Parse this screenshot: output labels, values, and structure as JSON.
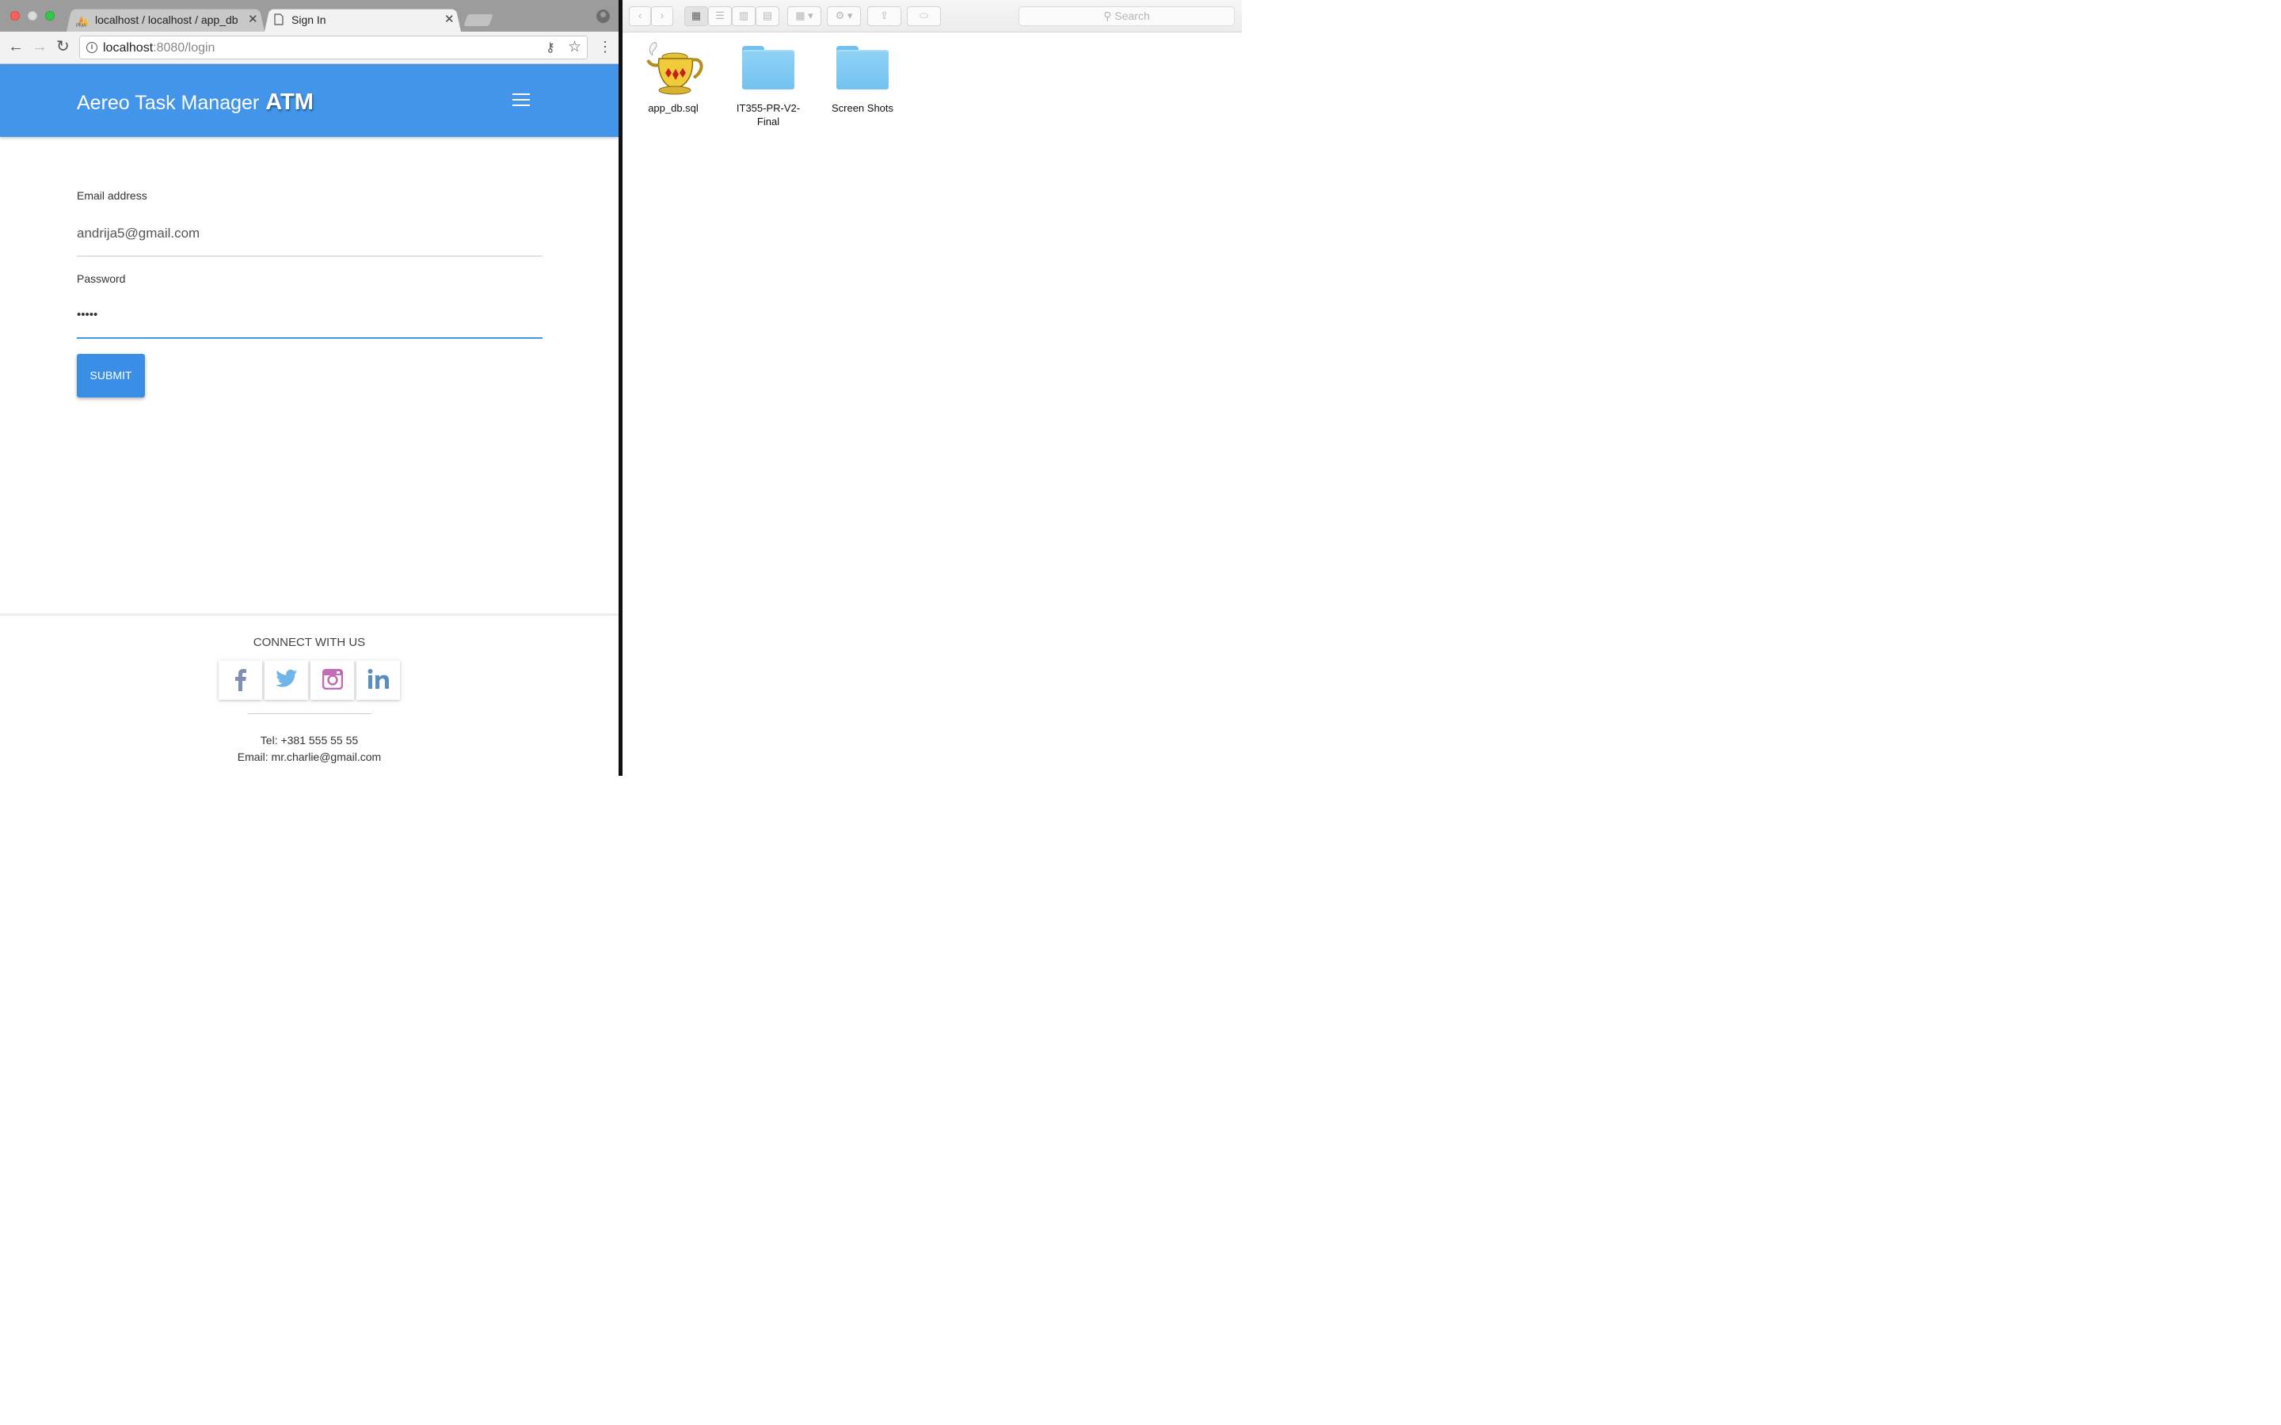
{
  "browser": {
    "tabs": [
      {
        "title": "localhost / localhost / app_db |",
        "favicon": "phpmyadmin-icon"
      },
      {
        "title": "Sign In",
        "favicon": "page-icon"
      }
    ],
    "url_host": "localhost",
    "url_rest": ":8080/login"
  },
  "page": {
    "brand": "Aereo Task Manager",
    "brand_short": "ATM",
    "email_label": "Email address",
    "email_value": "andrija5@gmail.com",
    "password_label": "Password",
    "password_value": "•••••",
    "submit_label": "SUBMIT",
    "footer": {
      "connect": "CONNECT WITH US",
      "social": [
        "facebook",
        "twitter",
        "instagram",
        "linkedin"
      ],
      "tel": "Tel: +381 555 55 55",
      "email": "Email: mr.charlie@gmail.com"
    },
    "accent": "#4295e8"
  },
  "finder": {
    "search_placeholder": "Search",
    "items": [
      {
        "name": "app_db.sql",
        "icon": "genie-lamp-file-icon"
      },
      {
        "name_line1": "IT355-PR-V2-",
        "name_line2": "Final",
        "icon": "folder-icon"
      },
      {
        "name": "Screen Shots",
        "icon": "folder-icon"
      }
    ]
  }
}
